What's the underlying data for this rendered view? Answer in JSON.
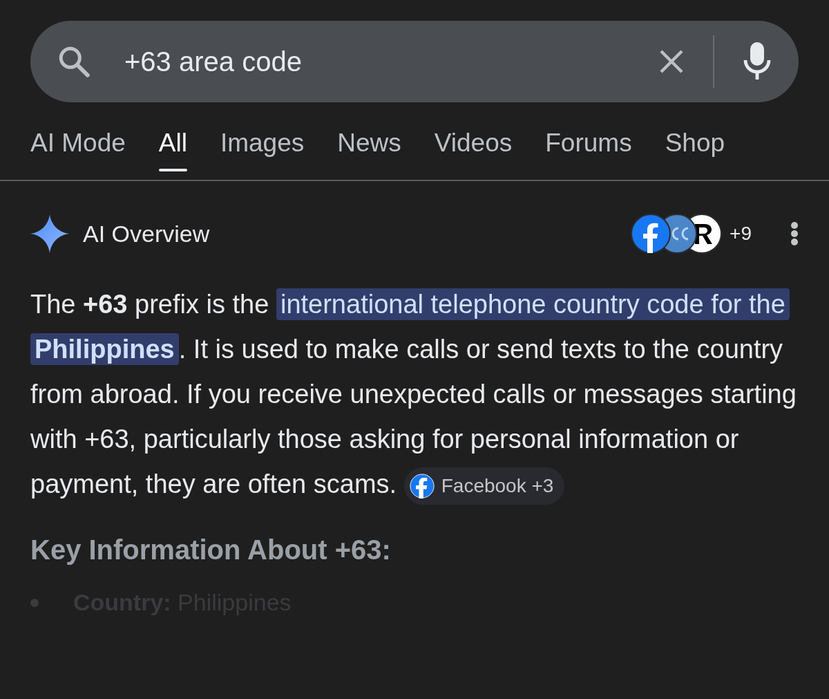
{
  "search": {
    "value": "+63 area code"
  },
  "tabs": [
    {
      "label": "AI Mode",
      "selected": false
    },
    {
      "label": "All",
      "selected": true
    },
    {
      "label": "Images",
      "selected": false
    },
    {
      "label": "News",
      "selected": false
    },
    {
      "label": "Videos",
      "selected": false
    },
    {
      "label": "Forums",
      "selected": false
    },
    {
      "label": "Shop",
      "selected": false
    }
  ],
  "overview": {
    "title": "AI Overview",
    "source_count": "+9",
    "paragraph": [
      {
        "text": "The **+63** prefix is the ",
        "highlighted": false
      },
      {
        "text": "international telephone country code for the **Philippines**",
        "highlighted": true
      },
      {
        "text": ". It is used to make calls or send texts to the country from abroad. If you receive unexpected calls or messages starting with +63, particularly those asking for personal information or payment, they are often scams. ",
        "highlighted": false
      }
    ],
    "source_chip": "Facebook +3",
    "heading": "Key Information About +63:",
    "bullets": [
      {
        "label": "Country:",
        "value": "Philippines"
      }
    ]
  }
}
